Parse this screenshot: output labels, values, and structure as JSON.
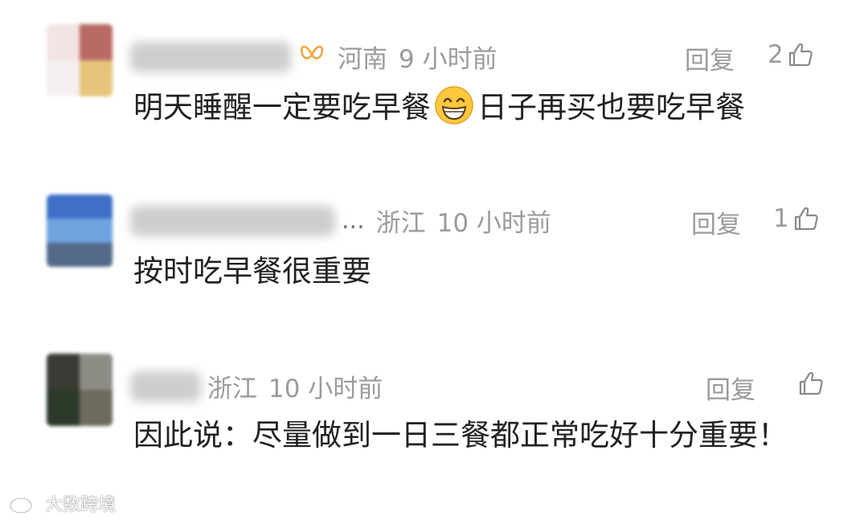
{
  "comments": [
    {
      "username": "(blurred)",
      "badge_icon": "butterfly-badge-icon",
      "region": "河南",
      "time": "9 小时前",
      "reply_label": "回复",
      "like_count": "2",
      "like_icon": "thumbs-up-icon",
      "text_before_emoji": "明天睡醒一定要吃早餐",
      "emoji": "grinning-face-emoji",
      "text_after_emoji": "日子再买也要吃早餐",
      "avatar_colors": [
        "#f3e3e3",
        "#b86b64",
        "#f5f0f0",
        "#e7c47a"
      ]
    },
    {
      "username": "(blurred)",
      "ellipsis": "...",
      "region": "浙江",
      "time": "10 小时前",
      "reply_label": "回复",
      "like_count": "1",
      "like_icon": "thumbs-up-icon",
      "text": "按时吃早餐很重要",
      "avatar_colors": [
        "#3f6fc7",
        "#6fa3e0",
        "#2e5aa8",
        "#536a8a"
      ]
    },
    {
      "username": "(blurred)",
      "region": "浙江",
      "time": "10 小时前",
      "reply_label": "回复",
      "like_count": "",
      "like_icon": "thumbs-up-icon",
      "text": "因此说：尽量做到一日三餐都正常吃好十分重要！",
      "avatar_colors": [
        "#3b3b36",
        "#8d8d86",
        "#2c3a2a",
        "#6e6a5e"
      ]
    }
  ],
  "watermark": {
    "icon": "weibo-logo-icon",
    "text": "大数跨境"
  },
  "colors": {
    "meta_gray": "#9b9b9b",
    "body_text": "#222222",
    "badge_orange": "#f2a33a"
  }
}
